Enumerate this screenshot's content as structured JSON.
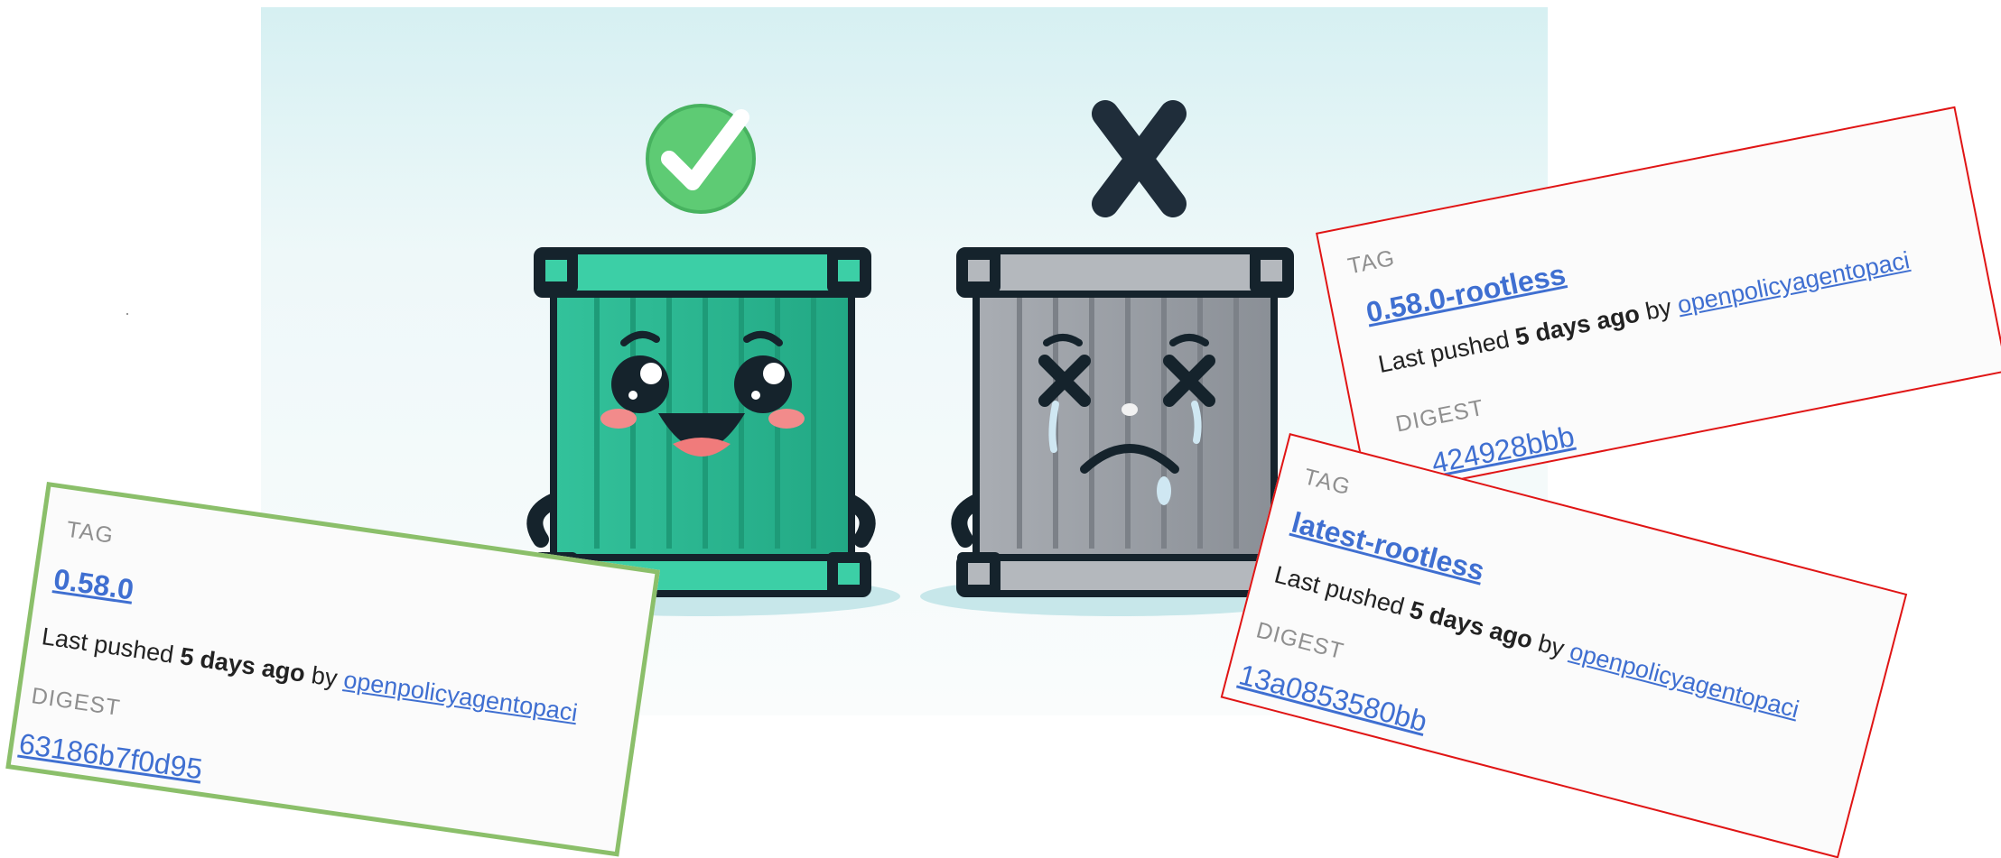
{
  "colors": {
    "link": "#3f6fd1",
    "good_border": "#8bbf6a",
    "bad_border": "#e01515",
    "good_container": "#3cc7a0",
    "bad_container": "#9a9fa6",
    "check_green": "#5ecb74",
    "x_dark": "#1f2d3a"
  },
  "illustration": {
    "icons": [
      "check-circle-icon",
      "x-mark-icon",
      "happy-container-icon",
      "sad-container-icon"
    ]
  },
  "cards": [
    {
      "tag_label": "TAG",
      "tag": "0.58.0",
      "pushed_prefix": "Last pushed ",
      "pushed_time": "5 days ago",
      "pushed_by": " by ",
      "publisher": "openpolicyagentopaci",
      "digest_label": "DIGEST",
      "digest": "63186b7f0d95"
    },
    {
      "tag_label": "TAG",
      "tag": "0.58.0-rootless",
      "pushed_prefix": "Last pushed ",
      "pushed_time": "5 days ago",
      "pushed_by": " by ",
      "publisher": "openpolicyagentopaci",
      "digest_label": "DIGEST",
      "digest": "...424928bbb"
    },
    {
      "tag_label": "TAG",
      "tag": "latest-rootless",
      "pushed_prefix": "Last pushed ",
      "pushed_time": "5 days ago",
      "pushed_by": " by ",
      "publisher": "openpolicyagentopaci",
      "digest_label": "DIGEST",
      "digest": "13a0853580bb"
    }
  ]
}
